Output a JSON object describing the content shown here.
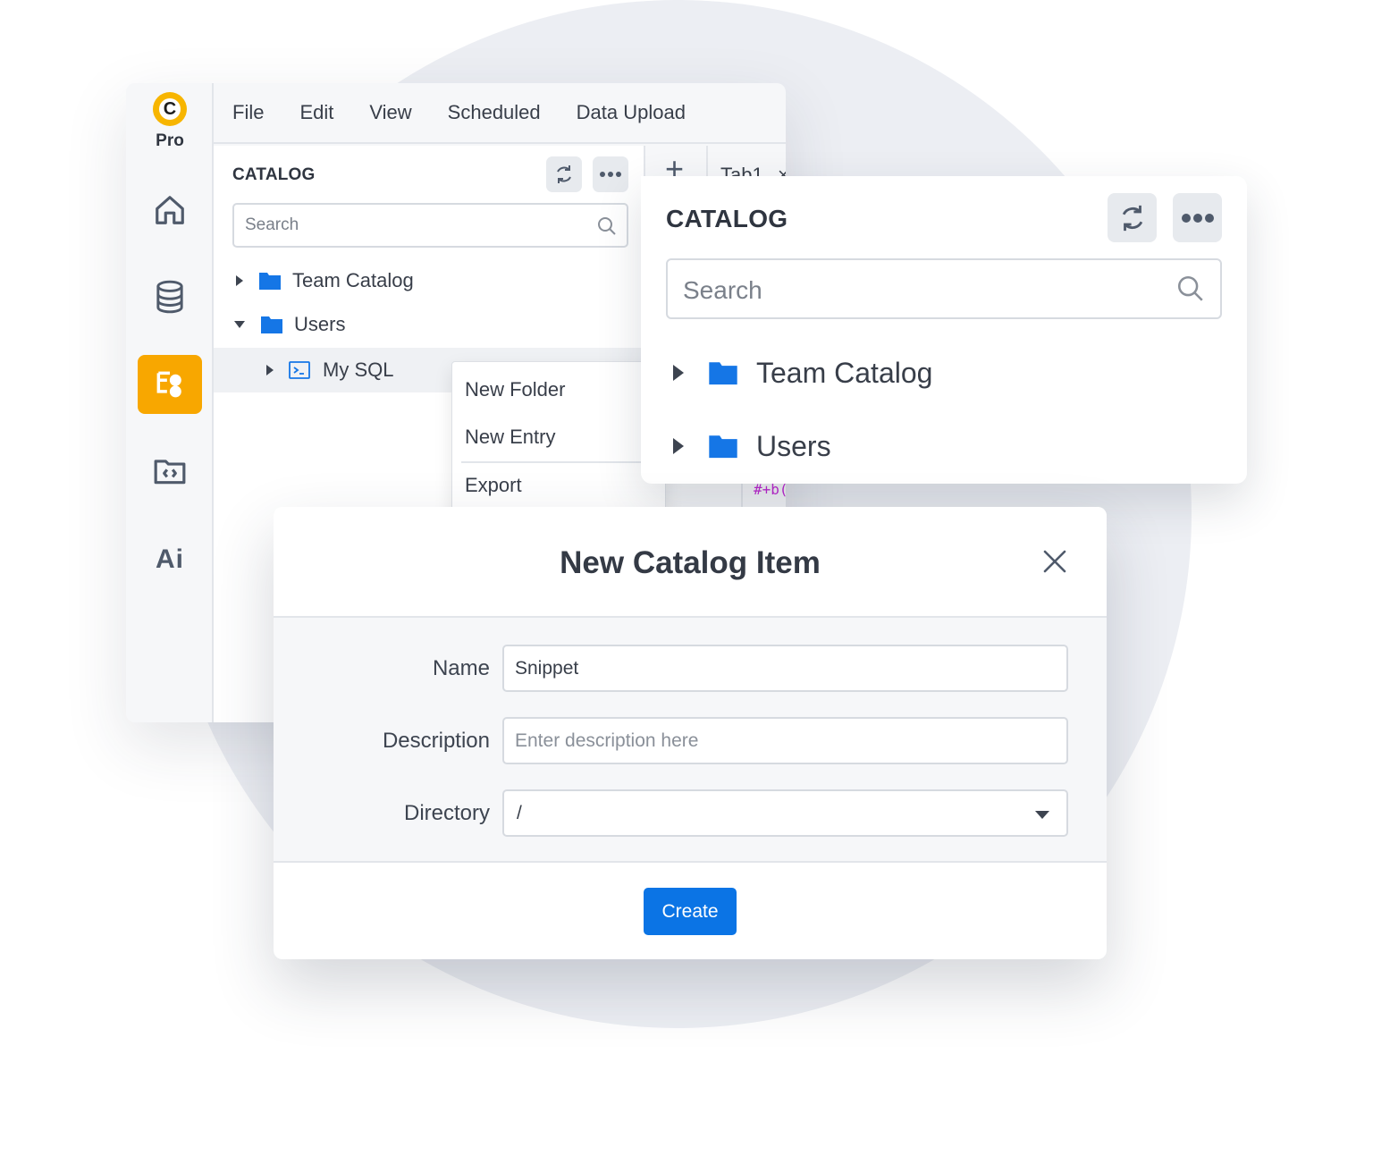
{
  "app": {
    "brand_badge": "Pro",
    "logo_letter": "C",
    "rail_ai_label": "Ai",
    "menu": [
      "File",
      "Edit",
      "View",
      "Scheduled",
      "Data Upload"
    ],
    "tab_label": "Tab1",
    "tab_close": "×",
    "add_tab_icon": "+"
  },
  "catalog_panel": {
    "title": "CATALOG",
    "search_placeholder": "Search",
    "items": [
      {
        "label": "Team Catalog",
        "expanded": false,
        "icon": "folder-icon"
      },
      {
        "label": "Users",
        "expanded": true,
        "icon": "folder-icon"
      },
      {
        "label": "My SQL",
        "expanded": false,
        "icon": "terminal-icon"
      }
    ]
  },
  "context_menu": {
    "items": [
      "New Folder",
      "New Entry",
      "Export"
    ]
  },
  "code_fragment": "#+b(",
  "catalog_card": {
    "title": "CATALOG",
    "search_placeholder": "Search",
    "items": [
      {
        "label": "Team Catalog",
        "icon": "folder-icon"
      },
      {
        "label": "Users",
        "icon": "folder-icon"
      }
    ]
  },
  "modal": {
    "title": "New Catalog Item",
    "fields": {
      "name_label": "Name",
      "name_value": "Snippet",
      "description_label": "Description",
      "description_placeholder": "Enter description here",
      "directory_label": "Directory",
      "directory_value": "/"
    },
    "create_label": "Create"
  },
  "colors": {
    "accent_orange": "#f8a700",
    "primary_blue": "#0b74e5",
    "folder_blue": "#1576e6",
    "code_magenta": "#c026d3"
  }
}
